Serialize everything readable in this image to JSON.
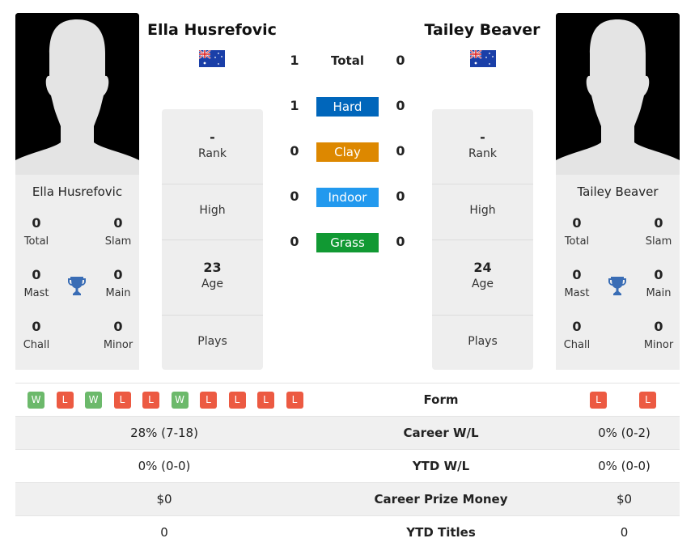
{
  "h2h": {
    "total_label": "Total",
    "left_total": "1",
    "right_total": "0",
    "surfaces": [
      {
        "name": "Hard",
        "left": "1",
        "right": "0",
        "color": "#0066bb"
      },
      {
        "name": "Clay",
        "left": "0",
        "right": "0",
        "color": "#dd8800"
      },
      {
        "name": "Indoor",
        "left": "0",
        "right": "0",
        "color": "#2299ee"
      },
      {
        "name": "Grass",
        "left": "0",
        "right": "0",
        "color": "#119933"
      }
    ]
  },
  "players": [
    {
      "name": "Ella Husrefovic",
      "flag": "australia-flag",
      "rank": "-",
      "rank_label": "Rank",
      "high": "",
      "high_label": "High",
      "age": "23",
      "age_label": "Age",
      "plays": "",
      "plays_label": "Plays",
      "titles": {
        "total": "0",
        "total_label": "Total",
        "slam": "0",
        "slam_label": "Slam",
        "mast": "0",
        "mast_label": "Mast",
        "main": "0",
        "main_label": "Main",
        "chall": "0",
        "chall_label": "Chall",
        "minor": "0",
        "minor_label": "Minor"
      },
      "form": [
        "W",
        "L",
        "W",
        "L",
        "L",
        "W",
        "L",
        "L",
        "L",
        "L"
      ]
    },
    {
      "name": "Tailey Beaver",
      "flag": "australia-flag",
      "rank": "-",
      "rank_label": "Rank",
      "high": "",
      "high_label": "High",
      "age": "24",
      "age_label": "Age",
      "plays": "",
      "plays_label": "Plays",
      "titles": {
        "total": "0",
        "total_label": "Total",
        "slam": "0",
        "slam_label": "Slam",
        "mast": "0",
        "mast_label": "Mast",
        "main": "0",
        "main_label": "Main",
        "chall": "0",
        "chall_label": "Chall",
        "minor": "0",
        "minor_label": "Minor"
      },
      "form": [
        "L",
        "L"
      ]
    }
  ],
  "comparison": [
    {
      "label": "Form",
      "left": "",
      "right": ""
    },
    {
      "label": "Career W/L",
      "left": "28% (7-18)",
      "right": "0% (0-2)"
    },
    {
      "label": "YTD W/L",
      "left": "0% (0-0)",
      "right": "0% (0-0)"
    },
    {
      "label": "Career Prize Money",
      "left": "$0",
      "right": "$0"
    },
    {
      "label": "YTD Titles",
      "left": "0",
      "right": "0"
    }
  ],
  "colors": {
    "win": "#6cb96b",
    "loss": "#ec5a42",
    "trophy": "#3a6db5"
  }
}
